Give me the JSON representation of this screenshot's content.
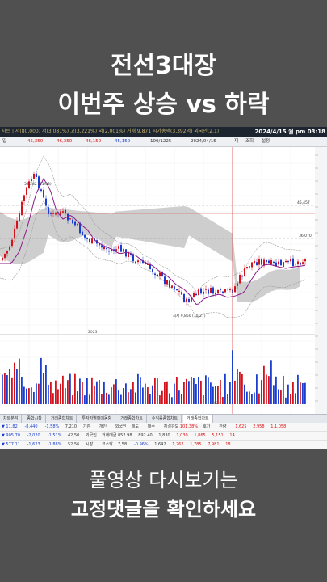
{
  "overlay": {
    "title_line1": "전선3대장",
    "title_line2": "이번주 상승 vs 하락",
    "caption_line1": "풀영상 다시보기는",
    "caption_line2": "고정댓글을 확인하세요"
  },
  "terminal": {
    "datetime": "2024/4/15 월 pm 03:18",
    "info_text": "차트 | 저(80,000) 저(3,081%) 고(3,221%) 외(2,001%) 거래 9,871 시가총액(3,392억) 외국인(2.1)",
    "toolbar": {
      "period": "일",
      "price_marks": [
        "45,350",
        "46,350",
        "46,150",
        "45,150"
      ],
      "range": "100/1225",
      "date_field": "2024/04/15",
      "buttons": [
        "재",
        "조회",
        "설정"
      ]
    },
    "price_labels": {
      "high_marker": "52,282 (01/03)",
      "low_marker": "최저 9,850 (10/27)",
      "level_upper": "45,457",
      "level_lower": "36,070",
      "year_label": "2023",
      "year_label_lower": "2024"
    },
    "tabs": [
      "차트분석",
      "종합시황",
      "거래종합차트",
      "투자자별매매동향",
      "거래종합차트",
      "수익률종합차트",
      "거래종합차트"
    ],
    "active_tab": 6,
    "orders": {
      "row1": [
        "▼ 11.82",
        "-8,440",
        "-1.58%",
        "7,210",
        "기관",
        "개인",
        "외국인",
        "매도",
        "매수",
        "체결강도",
        "101.38%",
        "호가",
        "잔량",
        "1,625",
        "2,958",
        "1,1,058"
      ],
      "row2": [
        "▼ 905.70",
        "-2,020",
        "-1.51%",
        "42,50",
        "외국인",
        "거래대금",
        "852.98",
        "892.40",
        "1,830",
        "1,030",
        "1,865",
        "5,151",
        "14"
      ],
      "row3": [
        "▼ 577.11",
        "-1,623",
        "-1.88%",
        "52,56",
        "시장",
        "코스닥",
        "7,58",
        "-0.96%",
        "1,642",
        "1,262",
        "1,785",
        "7,981",
        "18"
      ]
    }
  },
  "chart_data": {
    "type": "candlestick",
    "panels": [
      "price",
      "volume"
    ],
    "overlays": [
      "moving-average",
      "bollinger-bands",
      "ichimoku-cloud"
    ],
    "colors": {
      "up": "#d4121b",
      "down": "#1a3fd0",
      "ma": "#8a1a8a",
      "band": "#aaaaaa",
      "cloud": "#c6c6c6"
    }
  }
}
